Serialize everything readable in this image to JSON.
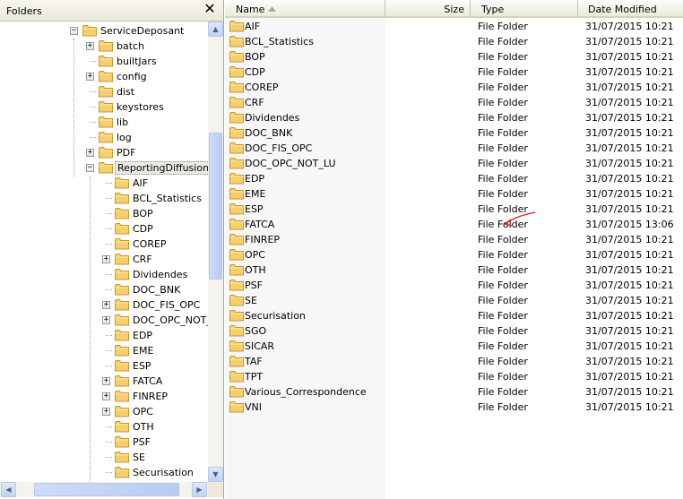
{
  "folders_pane": {
    "title": "Folders",
    "close_label": "✕",
    "tree": [
      {
        "label": "ServiceDeposant",
        "level": 0,
        "expander": "minus"
      },
      {
        "label": "batch",
        "level": 1,
        "expander": "plus"
      },
      {
        "label": "builtJars",
        "level": 1,
        "expander": "none"
      },
      {
        "label": "config",
        "level": 1,
        "expander": "plus"
      },
      {
        "label": "dist",
        "level": 1,
        "expander": "none"
      },
      {
        "label": "keystores",
        "level": 1,
        "expander": "none"
      },
      {
        "label": "lib",
        "level": 1,
        "expander": "none"
      },
      {
        "label": "log",
        "level": 1,
        "expander": "none"
      },
      {
        "label": "PDF",
        "level": 1,
        "expander": "plus"
      },
      {
        "label": "ReportingDiffusion",
        "level": 1,
        "expander": "minus",
        "selected": true
      },
      {
        "label": "AIF",
        "level": 2,
        "expander": "none"
      },
      {
        "label": "BCL_Statistics",
        "level": 2,
        "expander": "none"
      },
      {
        "label": "BOP",
        "level": 2,
        "expander": "none"
      },
      {
        "label": "CDP",
        "level": 2,
        "expander": "none"
      },
      {
        "label": "COREP",
        "level": 2,
        "expander": "none"
      },
      {
        "label": "CRF",
        "level": 2,
        "expander": "plus"
      },
      {
        "label": "Dividendes",
        "level": 2,
        "expander": "none"
      },
      {
        "label": "DOC_BNK",
        "level": 2,
        "expander": "none"
      },
      {
        "label": "DOC_FIS_OPC",
        "level": 2,
        "expander": "plus"
      },
      {
        "label": "DOC_OPC_NOT_",
        "level": 2,
        "expander": "plus"
      },
      {
        "label": "EDP",
        "level": 2,
        "expander": "none"
      },
      {
        "label": "EME",
        "level": 2,
        "expander": "none"
      },
      {
        "label": "ESP",
        "level": 2,
        "expander": "none"
      },
      {
        "label": "FATCA",
        "level": 2,
        "expander": "plus"
      },
      {
        "label": "FINREP",
        "level": 2,
        "expander": "plus"
      },
      {
        "label": "OPC",
        "level": 2,
        "expander": "plus"
      },
      {
        "label": "OTH",
        "level": 2,
        "expander": "none"
      },
      {
        "label": "PSF",
        "level": 2,
        "expander": "none"
      },
      {
        "label": "SE",
        "level": 2,
        "expander": "none"
      },
      {
        "label": "Securisation",
        "level": 2,
        "expander": "none"
      }
    ]
  },
  "columns": {
    "name": "Name",
    "size": "Size",
    "type": "Type",
    "date": "Date Modified"
  },
  "files": [
    {
      "name": "AIF",
      "type": "File Folder",
      "date": "31/07/2015 10:21"
    },
    {
      "name": "BCL_Statistics",
      "type": "File Folder",
      "date": "31/07/2015 10:21"
    },
    {
      "name": "BOP",
      "type": "File Folder",
      "date": "31/07/2015 10:21"
    },
    {
      "name": "CDP",
      "type": "File Folder",
      "date": "31/07/2015 10:21"
    },
    {
      "name": "COREP",
      "type": "File Folder",
      "date": "31/07/2015 10:21"
    },
    {
      "name": "CRF",
      "type": "File Folder",
      "date": "31/07/2015 10:21"
    },
    {
      "name": "Dividendes",
      "type": "File Folder",
      "date": "31/07/2015 10:21"
    },
    {
      "name": "DOC_BNK",
      "type": "File Folder",
      "date": "31/07/2015 10:21"
    },
    {
      "name": "DOC_FIS_OPC",
      "type": "File Folder",
      "date": "31/07/2015 10:21"
    },
    {
      "name": "DOC_OPC_NOT_LU",
      "type": "File Folder",
      "date": "31/07/2015 10:21"
    },
    {
      "name": "EDP",
      "type": "File Folder",
      "date": "31/07/2015 10:21"
    },
    {
      "name": "EME",
      "type": "File Folder",
      "date": "31/07/2015 10:21"
    },
    {
      "name": "ESP",
      "type": "File Folder",
      "date": "31/07/2015 10:21"
    },
    {
      "name": "FATCA",
      "type": "File Folder",
      "date": "31/07/2015 13:06"
    },
    {
      "name": "FINREP",
      "type": "File Folder",
      "date": "31/07/2015 10:21"
    },
    {
      "name": "OPC",
      "type": "File Folder",
      "date": "31/07/2015 10:21"
    },
    {
      "name": "OTH",
      "type": "File Folder",
      "date": "31/07/2015 10:21"
    },
    {
      "name": "PSF",
      "type": "File Folder",
      "date": "31/07/2015 10:21"
    },
    {
      "name": "SE",
      "type": "File Folder",
      "date": "31/07/2015 10:21"
    },
    {
      "name": "Securisation",
      "type": "File Folder",
      "date": "31/07/2015 10:21"
    },
    {
      "name": "SGO",
      "type": "File Folder",
      "date": "31/07/2015 10:21"
    },
    {
      "name": "SICAR",
      "type": "File Folder",
      "date": "31/07/2015 10:21"
    },
    {
      "name": "TAF",
      "type": "File Folder",
      "date": "31/07/2015 10:21"
    },
    {
      "name": "TPT",
      "type": "File Folder",
      "date": "31/07/2015 10:21"
    },
    {
      "name": "Various_Correspondence",
      "type": "File Folder",
      "date": "31/07/2015 10:21"
    },
    {
      "name": "VNI",
      "type": "File Folder",
      "date": "31/07/2015 10:21"
    }
  ],
  "icons": {
    "folder": "folder-icon",
    "annotation": "red-arrow-annotation",
    "sort": "sort-ascending-icon"
  },
  "colors": {
    "folder_fill": "#f5d06a",
    "folder_border": "#c8962c",
    "annotation": "#e0201a",
    "sorted_column_bg": "#f7f7f7"
  }
}
